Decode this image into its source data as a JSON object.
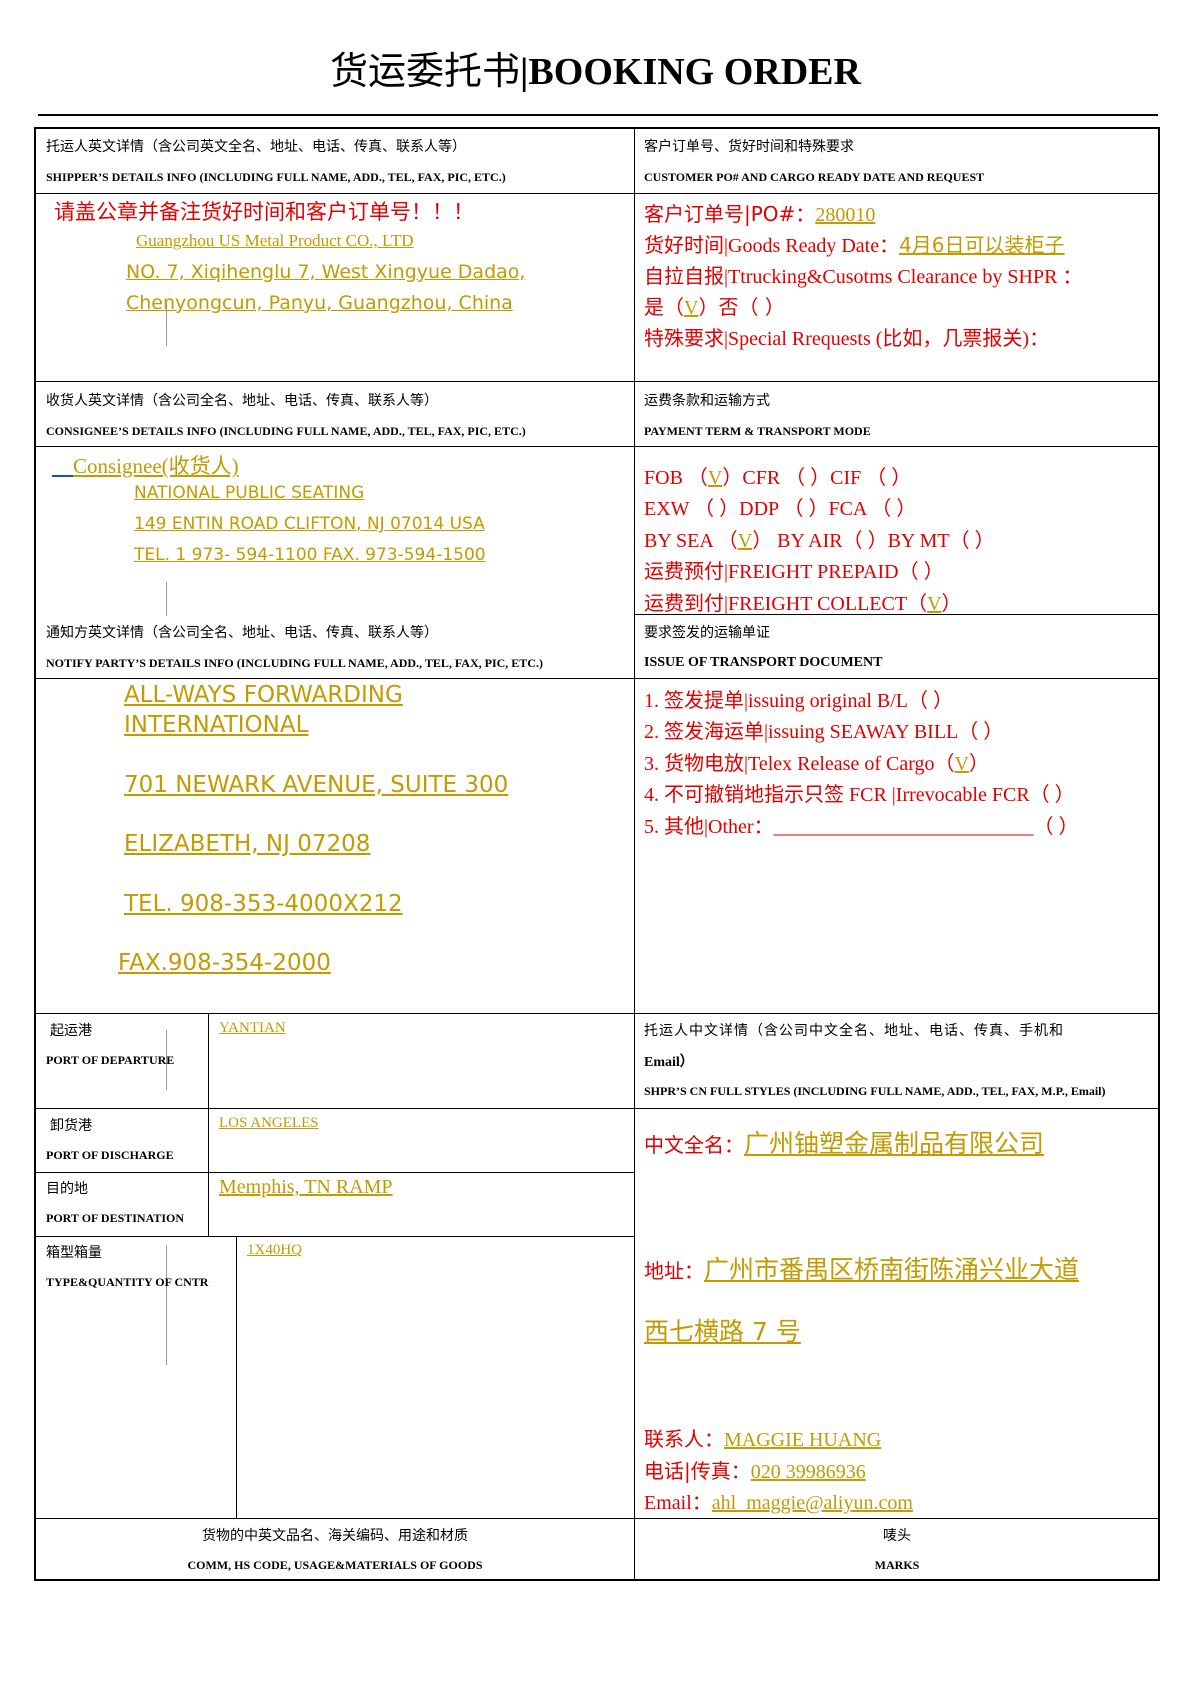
{
  "title": {
    "zh": "货运委托书",
    "sep": "|",
    "en": "BOOKING ORDER"
  },
  "shipper": {
    "label_zh": "托运人英文详情（含公司英文全名、地址、电话、传真、联系人等）",
    "label_en": "SHIPPER’S DETAILS INFO (INCLUDING FULL NAME, ADD., TEL, FAX, PIC, ETC.)",
    "note": "请盖公章并备注货好时间和客户订单号！！！",
    "name": "Guangzhou US Metal Product CO., LTD",
    "addr1": "NO. 7, Xiqihenglu 7, West Xingyue Dadao,",
    "addr2": "Chenyongcun, Panyu, Guangzhou, China"
  },
  "customer": {
    "label_zh": "客户订单号、货好时间和特殊要求",
    "label_en": "CUSTOMER PO# AND CARGO READY DATE AND REQUEST",
    "po_label": "客户订单号|PO#：",
    "po_value": "280010",
    "ready_label": "货好时间|Goods Ready Date：",
    "ready_value": "4月6日可以装柜子",
    "trucking": "自拉自报|Ttrucking&Cusotms Clearance by SHPR ：",
    "yes_a": "是（",
    "yes_mark": "V",
    "yes_b": "）否（    ）",
    "special": "特殊要求|Special Rrequests (比如，几票报关)："
  },
  "consignee": {
    "label_zh": "收货人英文详情（含公司全名、地址、电话、传真、联系人等）",
    "label_en": "CONSIGNEE’S DETAILS INFO (INCLUDING FULL NAME, ADD., TEL, FAX, PIC, ETC.)",
    "title": "Consignee(收货人)",
    "name": "NATIONAL  PUBLIC  SEATING",
    "addr": "149  ENTIN  ROAD  CLIFTON,  NJ  07014  USA",
    "tel": "TEL. 1 973- 594-1100  FAX. 973-594-1500"
  },
  "payment": {
    "label_zh": "运费条款和运输方式",
    "label_en": "PAYMENT TERM & TRANSPORT MODE",
    "fob": "FOB （",
    "fob_mark": "V",
    "fob_rest": "）CFR （    ）CIF （    ）",
    "exw": "EXW （    ）DDP （    ）FCA （    ）",
    "sea": "BY SEA （",
    "sea_mark": "V",
    "sea_rest": "） BY AIR（    ）BY MT（    ）",
    "prepaid": "运费预付|FREIGHT PREPAID（    ）",
    "collect": "运费到付|FREIGHT COLLECT（",
    "collect_mark": "V",
    "collect_rest": "）"
  },
  "notify": {
    "label_zh": "通知方英文详情（含公司全名、地址、电话、传真、联系人等）",
    "label_en": "NOTIFY PARTY’S DETAILS INFO (INCLUDING FULL NAME, ADD., TEL, FAX, PIC, ETC.)",
    "line1": "ALL-WAYS FORWARDING ",
    "line2": "INTERNATIONAL",
    "line3": "701 NEWARK AVENUE, SUITE 300",
    "line4": "ELIZABETH, NJ 07208",
    "line5": "TEL. 908-353-4000X212",
    "line6": "FAX.908-354-2000"
  },
  "transport_doc": {
    "label_zh": "要求签发的运输单证",
    "label_en": "ISSUE OF TRANSPORT DOCUMENT",
    "opt1": "1. 签发提单|issuing original B/L（    ）",
    "opt2": "2. 签发海运单|issuing SEAWAY BILL（    ）",
    "opt3": "3. 货物电放|Telex Release of Cargo（",
    "opt3_mark": "V",
    "opt3_rest": "）",
    "opt4": "4. 不可撤销地指示只签 FCR |Irrevocable FCR（    ）",
    "opt5": "5. 其他|Other：__________________________（    ）"
  },
  "departure": {
    "label_zh": "起运港",
    "label_en": "PORT OF DEPARTURE",
    "value": "YANTIAN"
  },
  "discharge": {
    "label_zh": "卸货港",
    "label_en": "PORT OF DISCHARGE",
    "value": "LOS ANGELES "
  },
  "destination": {
    "label_zh": "目的地",
    "label_en": "PORT OF DESTINATION",
    "value": " Memphis, TN RAMP"
  },
  "cntr": {
    "label_zh": "箱型箱量",
    "label_en": "TYPE&QUANTITY OF CNTR",
    "value": "1X40HQ"
  },
  "shipper_cn": {
    "label_zh1": "托运人中文详情（含公司中文全名、地址、电话、传真、手机和",
    "label_zh2": "Email）",
    "label_en": "SHPR’S CN FULL STYLES (INCLUDING FULL NAME, ADD., TEL, FAX, M.P., Email)",
    "name_label": "中文全名：",
    "name_value": "广州铀塑金属制品有限公司",
    "addr_label": "地址：",
    "addr_value1": "广州市番禺区桥南街陈涌兴业大道",
    "addr_value2": "西七横路 7 号",
    "contact_label": "联系人：",
    "contact_value": "MAGGIE HUANG",
    "phone_label": "电话|传真：",
    "phone_value": "020 39986936",
    "email_label": "Email：",
    "email_value": "ahl_maggie@aliyun.com"
  },
  "goods": {
    "label_zh": "货物的中英文品名、海关编码、用途和材质",
    "label_en": "COMM, HS CODE, USAGE&MATERIALS OF GOODS"
  },
  "marks": {
    "label_zh": "唛头",
    "label_en": "MARKS"
  }
}
